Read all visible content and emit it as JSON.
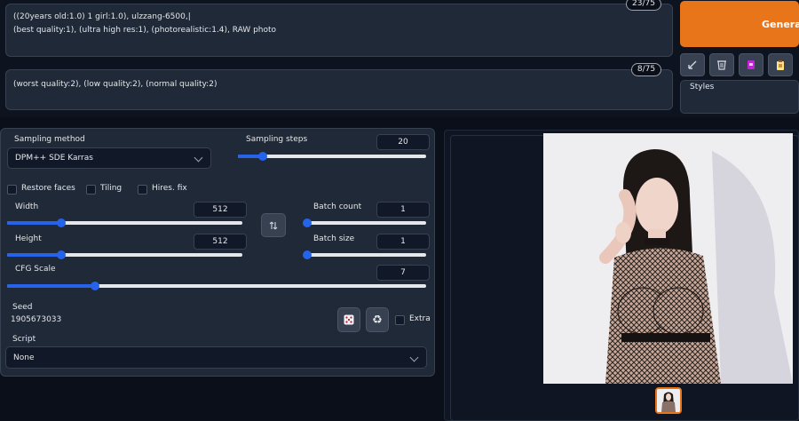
{
  "prompt": {
    "positive_lines": [
      "((20years old:1.0) 1 girl:1.0), ulzzang-6500,|",
      "(best quality:1), (ultra high res:1), (photorealistic:1.4), RAW photo"
    ],
    "positive_counter": "23/75",
    "negative_text": "(worst quality:2), (low quality:2), (normal quality:2)",
    "negative_counter": "8/75"
  },
  "toolbar": {
    "generate_label": "Generate",
    "styles_label": "Styles",
    "tools": [
      "arrow-icon",
      "trash-icon",
      "card-icon",
      "clipboard-icon"
    ]
  },
  "settings": {
    "sampling_method": {
      "label": "Sampling method",
      "value": "DPM++ SDE Karras"
    },
    "sampling_steps": {
      "label": "Sampling steps",
      "value": "20",
      "fraction": 0.13
    },
    "restore_faces": "Restore faces",
    "tiling": "Tiling",
    "hires_fix": "Hires. fix",
    "width": {
      "label": "Width",
      "value": "512",
      "fraction": 0.23
    },
    "height": {
      "label": "Height",
      "value": "512",
      "fraction": 0.23
    },
    "batch_count": {
      "label": "Batch count",
      "value": "1",
      "fraction": 0.0
    },
    "batch_size": {
      "label": "Batch size",
      "value": "1",
      "fraction": 0.0
    },
    "cfg_scale": {
      "label": "CFG Scale",
      "value": "7",
      "fraction": 0.21
    },
    "seed": {
      "label": "Seed",
      "value": "1905673033",
      "extra_label": "Extra"
    },
    "script": {
      "label": "Script",
      "value": "None"
    }
  },
  "colors": {
    "accent": "#2563eb",
    "generate": "#e8751a",
    "background": "#0b0f19",
    "panel": "#1f2937"
  }
}
